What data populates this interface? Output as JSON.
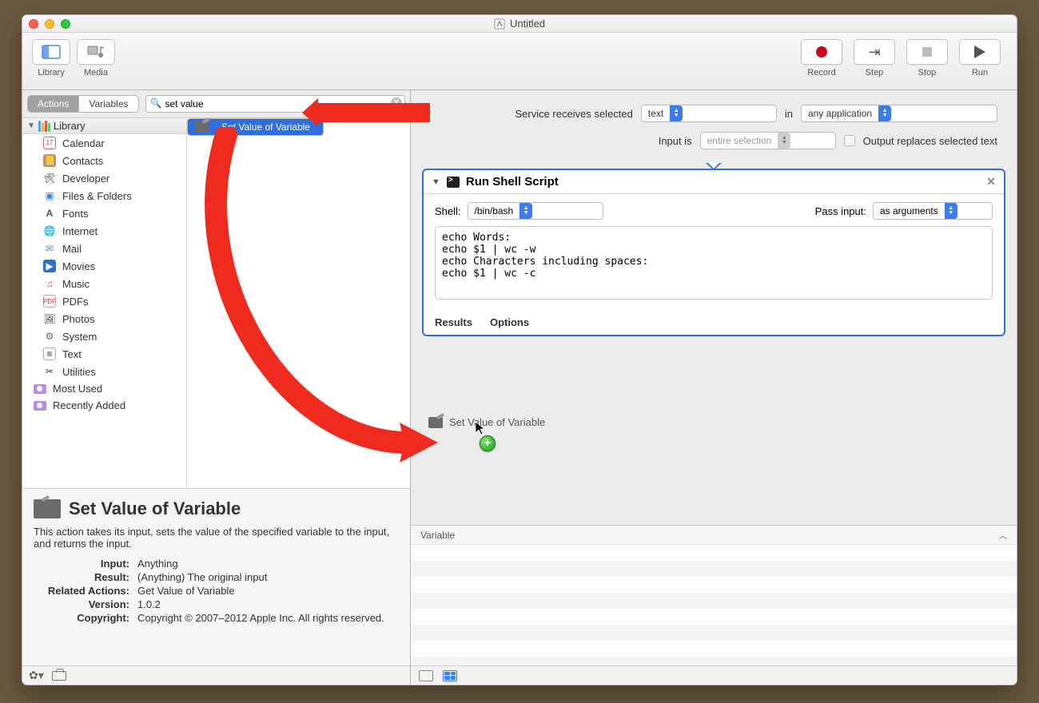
{
  "window_title": "Untitled",
  "toolbar": {
    "library_label": "Library",
    "media_label": "Media",
    "record_label": "Record",
    "step_label": "Step",
    "stop_label": "Stop",
    "run_label": "Run"
  },
  "segmented": {
    "actions": "Actions",
    "variables": "Variables"
  },
  "search": {
    "value": "set value",
    "placeholder": ""
  },
  "library_header": "Library",
  "categories": [
    "Calendar",
    "Contacts",
    "Developer",
    "Files & Folders",
    "Fonts",
    "Internet",
    "Mail",
    "Movies",
    "Music",
    "PDFs",
    "Photos",
    "System",
    "Text",
    "Utilities"
  ],
  "smart_groups": {
    "most_used": "Most Used",
    "recently_added": "Recently Added"
  },
  "search_result": "Set Value of Variable",
  "description": {
    "title": "Set Value of Variable",
    "body": "This action takes its input, sets the value of the specified variable to the input, and returns the input.",
    "labels": {
      "input": "Input:",
      "result": "Result:",
      "related": "Related Actions:",
      "version": "Version:",
      "copyright": "Copyright:"
    },
    "values": {
      "input": "Anything",
      "result": "(Anything) The original input",
      "related": "Get Value of Variable",
      "version": "1.0.2",
      "copyright": "Copyright © 2007–2012 Apple Inc.  All rights reserved."
    }
  },
  "service": {
    "receives_label": "Service receives selected",
    "receives_value": "text",
    "in_label": "in",
    "app_value": "any application",
    "input_is_label": "Input is",
    "input_is_value": "entire selection",
    "output_replaces_label": "Output replaces selected text"
  },
  "action": {
    "title": "Run Shell Script",
    "shell_label": "Shell:",
    "shell_value": "/bin/bash",
    "pass_label": "Pass input:",
    "pass_value": "as arguments",
    "code": "echo Words:\necho $1 | wc -w\necho Characters including spaces:\necho $1 | wc -c",
    "results": "Results",
    "options": "Options"
  },
  "drag_ghost_label": "Set Value of Variable",
  "variable_panel_header": "Variable"
}
